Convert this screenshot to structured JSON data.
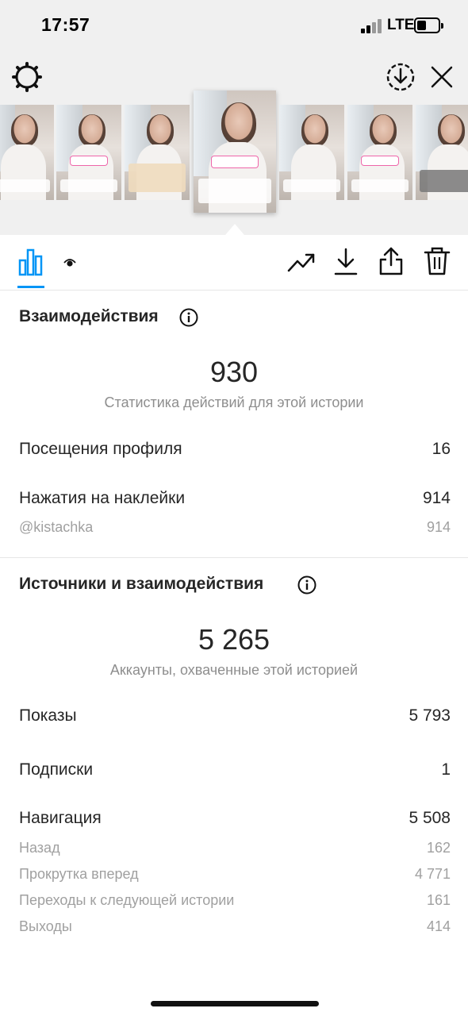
{
  "status_bar": {
    "time": "17:57",
    "network": "LTE",
    "icons": [
      "signal-icon",
      "battery-icon"
    ]
  },
  "top_bar": {
    "icons": [
      "settings-gear-icon",
      "download-circle-icon",
      "close-icon"
    ]
  },
  "thumbnails": {
    "count": 7,
    "selected_index": 3,
    "sticker_text": "@KISTACHKA"
  },
  "toolbar": {
    "tabs": [
      "bar-chart-icon",
      "eye-icon"
    ],
    "actions": [
      "trending-up-icon",
      "download-icon",
      "share-icon",
      "trash-icon"
    ],
    "accent_color": "#0095f6"
  },
  "interactions": {
    "title": "Взаимодействия",
    "total": "930",
    "caption": "Статистика действий для этой истории",
    "rows": [
      {
        "label": "Посещения профиля",
        "value": "16"
      },
      {
        "label": "Нажатия на наклейки",
        "value": "914"
      }
    ],
    "sub_rows": [
      {
        "label": "@kistachka",
        "value": "914"
      }
    ]
  },
  "discovery": {
    "title": "Источники и взаимодействия",
    "total": "5 265",
    "caption": "Аккаунты, охваченные этой историей",
    "rows": [
      {
        "label": "Показы",
        "value": "5 793"
      },
      {
        "label": "Подписки",
        "value": "1"
      },
      {
        "label": "Навигация",
        "value": "5 508"
      }
    ],
    "navigation_breakdown": [
      {
        "label": "Назад",
        "value": "162"
      },
      {
        "label": "Прокрутка вперед",
        "value": "4 771"
      },
      {
        "label": "Переходы к следующей истории",
        "value": "161"
      },
      {
        "label": "Выходы",
        "value": "414"
      }
    ]
  }
}
